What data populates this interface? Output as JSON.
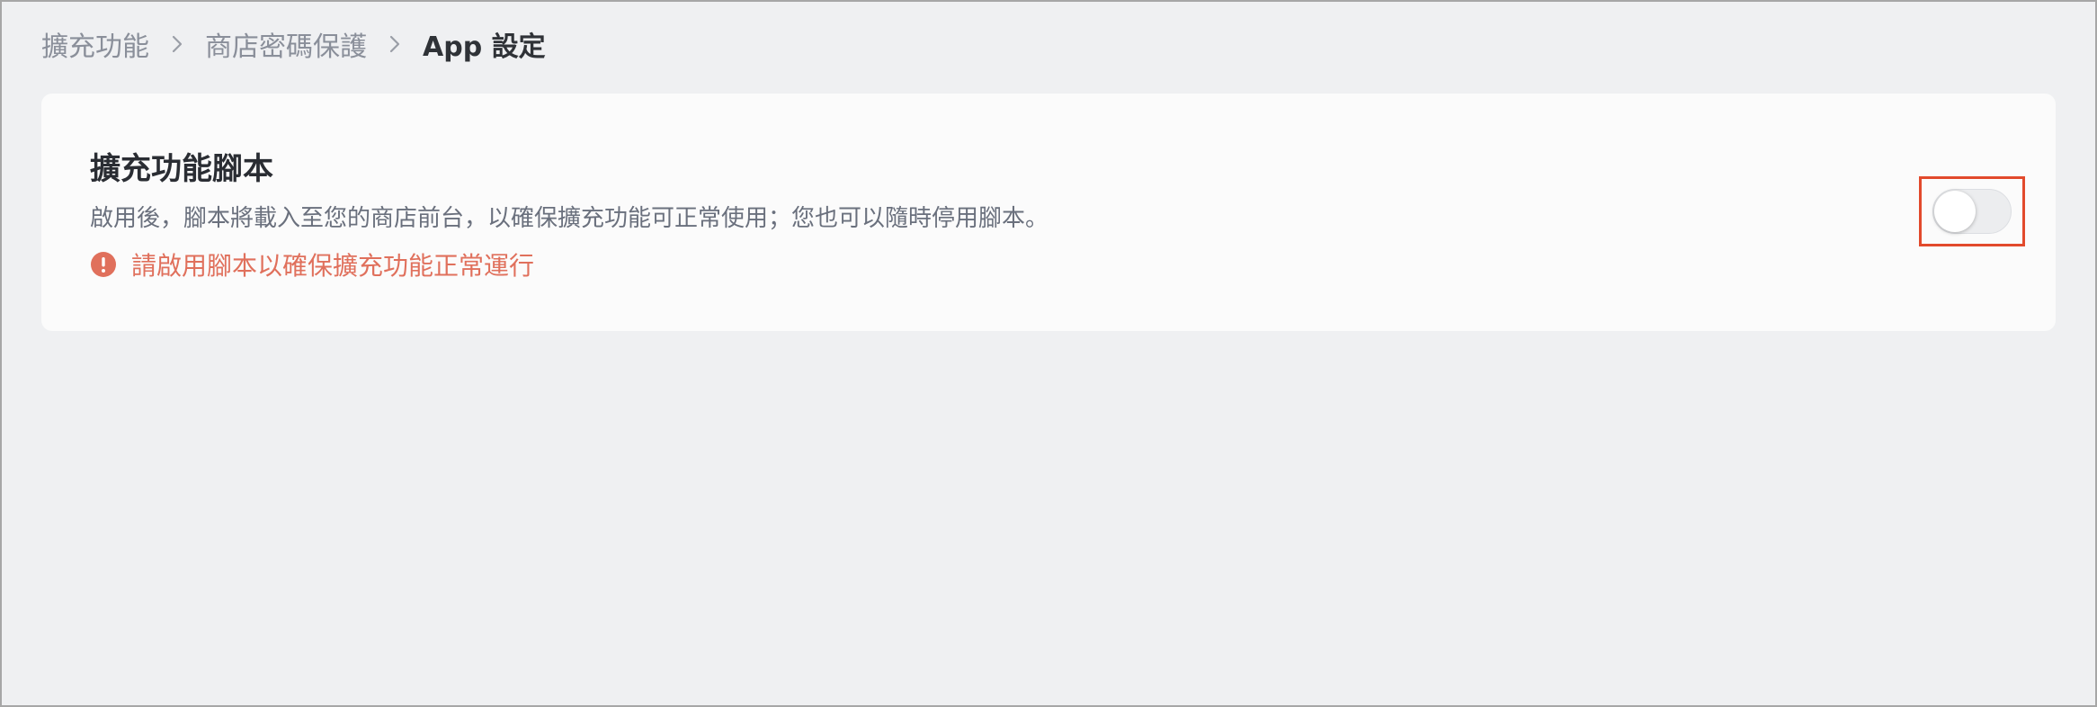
{
  "breadcrumb": {
    "items": [
      "擴充功能",
      "商店密碼保護"
    ],
    "current": "App 設定"
  },
  "script_card": {
    "title": "擴充功能腳本",
    "description": "啟用後，腳本將載入至您的商店前台，以確保擴充功能可正常使用；您也可以隨時停用腳本。",
    "warning": "請啟用腳本以確保擴充功能正常運行",
    "toggle_enabled": false
  },
  "icons": {
    "breadcrumb_separator": "chevron-right-icon",
    "warning": "exclamation-circle-icon"
  },
  "colors": {
    "background": "#eff0f2",
    "card": "#fbfbfb",
    "warning": "#e0705c",
    "highlight": "#e24a2c"
  }
}
